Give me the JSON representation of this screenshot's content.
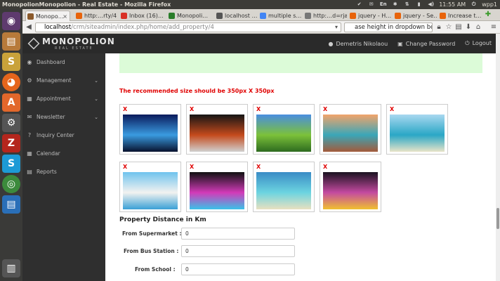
{
  "os": {
    "window_title": "MonopolionMonopolion - Real Estate - Mozilla Firefox",
    "clock": "11:55 AM",
    "user": "wpp1",
    "keyboard": "En"
  },
  "browser": {
    "tabs": [
      {
        "label": "Monopo…",
        "active": true,
        "color": "#8b5a2b"
      },
      {
        "label": "http:…rty/4",
        "active": false,
        "color": "#e8630a"
      },
      {
        "label": "Inbox (16)…",
        "active": false,
        "color": "#d93025"
      },
      {
        "label": "Monopoli…",
        "active": false,
        "color": "#2a7d2a"
      },
      {
        "label": "localhost …",
        "active": false,
        "color": "#555555"
      },
      {
        "label": "multiple s…",
        "active": false,
        "color": "#4285f4"
      },
      {
        "label": "http:…d=rja",
        "active": false,
        "color": "#777777"
      },
      {
        "label": "jquery - H…",
        "active": false,
        "color": "#e8630a"
      },
      {
        "label": "jquery - Se…",
        "active": false,
        "color": "#e8630a"
      },
      {
        "label": "Increase t…",
        "active": false,
        "color": "#e8630a"
      }
    ],
    "url_host": "localhost",
    "url_path": "/crm/siteadmin/index.php/home/add_property/4",
    "search_text": "ase height in dropdown box"
  },
  "app": {
    "logo_name": "MONOPOLION",
    "logo_sub": "REAL ESTATE",
    "user_name": "Demetris Nikolaou",
    "change_password": "Change Password",
    "logout": "Logout"
  },
  "sidebar": {
    "items": [
      {
        "label": "Dashboard",
        "icon": "tachometer-icon",
        "glyph": "◉",
        "chevron": false
      },
      {
        "label": "Management",
        "icon": "gear-icon",
        "glyph": "⚙",
        "chevron": true
      },
      {
        "label": "Appointment",
        "icon": "calendar-icon",
        "glyph": "▦",
        "chevron": true
      },
      {
        "label": "Newsletter",
        "icon": "comment-icon",
        "glyph": "✉",
        "chevron": true
      },
      {
        "label": "Inquiry Center",
        "icon": "question-icon",
        "glyph": "?",
        "chevron": false
      },
      {
        "label": "Calendar",
        "icon": "calendar-icon",
        "glyph": "▦",
        "chevron": false
      },
      {
        "label": "Reports",
        "icon": "report-icon",
        "glyph": "▤",
        "chevron": false
      }
    ]
  },
  "main": {
    "notice": "The recommended size should be 350px X 350px",
    "delete_mark": "X",
    "images": [
      {
        "name": "night-beach",
        "c1": "#0a1a5c",
        "c2": "#3a9be0",
        "c3": "#08122e"
      },
      {
        "name": "sports-car",
        "c1": "#151515",
        "c2": "#c44a1c",
        "c3": "#d0d0d0"
      },
      {
        "name": "green-field",
        "c1": "#4a8ee0",
        "c2": "#7cc13a",
        "c3": "#2d6b1f"
      },
      {
        "name": "sunset-beach",
        "c1": "#f2a46a",
        "c2": "#3aa6b8",
        "c3": "#a35a3a"
      },
      {
        "name": "island-resort",
        "c1": "#a9d8f0",
        "c2": "#2aa7c6",
        "c3": "#e8e4c8"
      },
      {
        "name": "beach-umbrella",
        "c1": "#6fc3ee",
        "c2": "#f2f2f0",
        "c3": "#3aa0d6"
      },
      {
        "name": "city-lights",
        "c1": "#111111",
        "c2": "#d23ab8",
        "c3": "#3ac2e8"
      },
      {
        "name": "atoll-aerial",
        "c1": "#3a8cc6",
        "c2": "#6cd4e0",
        "c3": "#e8e0c0"
      },
      {
        "name": "night-city",
        "c1": "#1a1220",
        "c2": "#c44aa0",
        "c3": "#f0c030"
      }
    ],
    "section_title": "Property Distance in Km",
    "fields": [
      {
        "label": "From Supermarket :",
        "value": "0"
      },
      {
        "label": "From Bus Station :",
        "value": "0"
      },
      {
        "label": "From School :",
        "value": "0"
      }
    ]
  }
}
